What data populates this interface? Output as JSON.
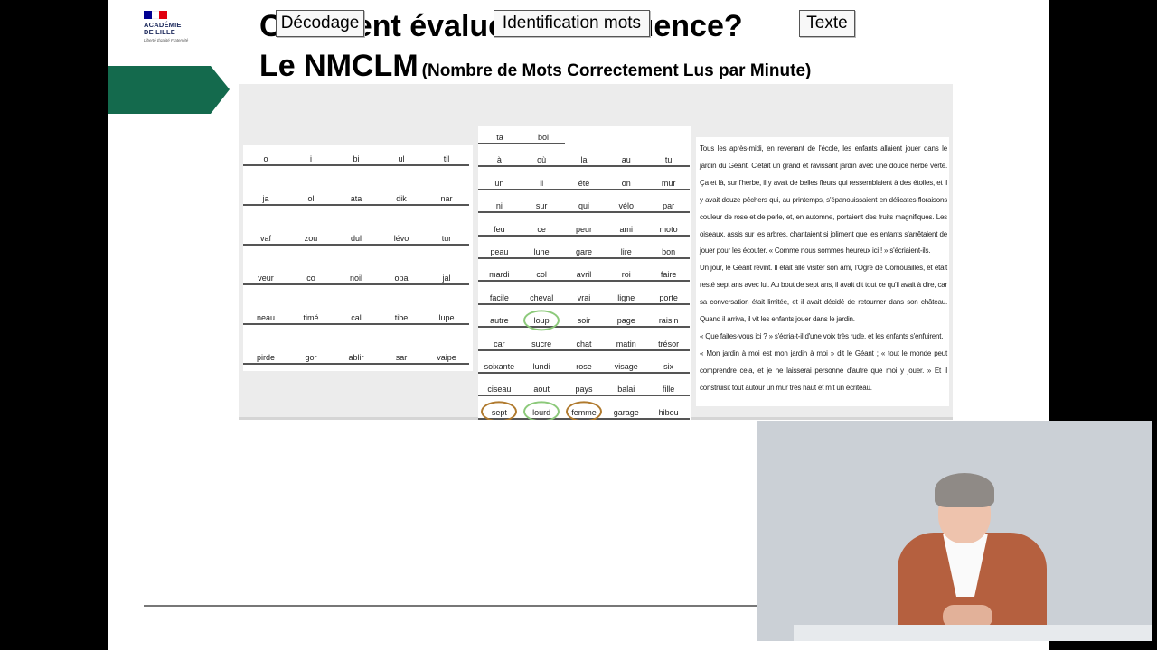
{
  "logo": {
    "line1": "ACADÉMIE",
    "line2": "DE LILLE",
    "motto": "Liberté Égalité Fraternité",
    "flag_colors": [
      "#000091",
      "#ffffff",
      "#e1000f"
    ]
  },
  "slide": {
    "title_line1": "Comment évalue-t-on la fluence?",
    "title_line2": "Le NMCLM",
    "title_sub": "(Nombre de Mots Correctement Lus par Minute)"
  },
  "headers": {
    "decodage": "Décodage",
    "identification": "Identification mots",
    "texte": "Texte"
  },
  "decodage_rows": [
    [
      "o",
      "i",
      "bi",
      "ul",
      "til"
    ],
    [
      "ja",
      "ol",
      "ata",
      "dik",
      "nar"
    ],
    [
      "vaf",
      "zou",
      "dul",
      "lévo",
      "tur"
    ],
    [
      "veur",
      "co",
      "noil",
      "opa",
      "jal"
    ],
    [
      "neau",
      "timé",
      "cal",
      "tibe",
      "lupe"
    ],
    [
      "pirde",
      "gor",
      "ablir",
      "sar",
      "vaipe"
    ]
  ],
  "identification_rows": [
    [
      "ta",
      "bol"
    ],
    [
      "à",
      "où",
      "la",
      "au",
      "tu"
    ],
    [
      "un",
      "il",
      "été",
      "on",
      "mur"
    ],
    [
      "ni",
      "sur",
      "qui",
      "vélo",
      "par"
    ],
    [
      "feu",
      "ce",
      "peur",
      "ami",
      "moto"
    ],
    [
      "peau",
      "lune",
      "gare",
      "lire",
      "bon"
    ],
    [
      "mardi",
      "col",
      "avril",
      "roi",
      "faire"
    ],
    [
      "facile",
      "cheval",
      "vrai",
      "ligne",
      "porte"
    ],
    [
      "autre",
      "loup",
      "soir",
      "page",
      "raisin"
    ],
    [
      "car",
      "sucre",
      "chat",
      "matin",
      "trésor"
    ],
    [
      "soixante",
      "lundi",
      "rose",
      "visage",
      "six"
    ],
    [
      "ciseau",
      "aout",
      "pays",
      "balai",
      "fille"
    ],
    [
      "sept",
      "lourd",
      "femme",
      "garage",
      "hibou"
    ]
  ],
  "text_paragraphs": [
    "Tous les après-midi, en revenant de l'école, les enfants allaient jouer dans le jardin du Géant. C'était un grand et ravissant jardin avec une douce herbe verte. Ça et là, sur l'herbe, il y avait de belles fleurs qui ressemblaient à des étoiles, et il y avait douze pêchers qui, au printemps, s'épanouissaient en délicates floraisons couleur de rose et de perle, et, en automne, portaient des fruits magnifiques. Les oiseaux, assis sur les arbres, chantaient si joliment que les enfants s'arrêtaient de jouer pour les écouter. « Comme nous sommes heureux ici ! » s'écriaient-ils.",
    "Un jour, le Géant revint. Il était allé visiter son ami, l'Ogre de Cornouailles, et était resté sept ans avec lui. Au bout de sept ans, il avait dit tout ce qu'il avait à dire, car sa conversation était limitée, et il avait décidé de retourner dans son château. Quand il arriva, il vit les enfants jouer dans le jardin.",
    "« Que faites-vous ici ? » s'écria-t-il d'une voix très rude, et les enfants s'enfuirent.",
    "« Mon jardin à moi est mon jardin à moi » dit le Géant ; « tout le monde peut comprendre cela, et je ne laisserai personne d'autre que moi y jouer. » Et il construisit tout autour un mur très haut et mit un écriteau."
  ],
  "circle_colors": {
    "green": "#8cc97a",
    "brown": "#b07a2e"
  },
  "video": {
    "description_icon": "presenter-video-icon"
  }
}
